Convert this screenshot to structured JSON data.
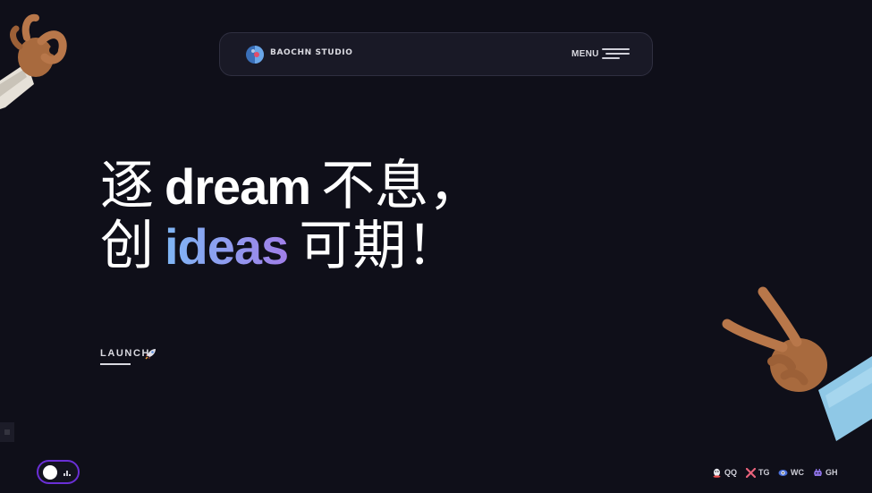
{
  "header": {
    "brand": "BAOCHN STUDIO",
    "menu_label": "MENU"
  },
  "hero": {
    "line1_part1": "逐",
    "line1_word": "dream",
    "line1_part2": "不息，",
    "line2_part1": "创",
    "line2_word": "ideas",
    "line2_part2": "可期！"
  },
  "launch": {
    "label": "LAUNCH"
  },
  "socials": {
    "qq": "QQ",
    "tg": "TG",
    "wc": "WC",
    "gh": "GH"
  },
  "colors": {
    "background": "#0f0f19",
    "navbar": "#191926",
    "gradient_start": "#7fb6f5",
    "gradient_end": "#a07ee8",
    "toggle_border": "#6a2fd6"
  },
  "icons": [
    "logo-icon",
    "menu-icon",
    "rocket-icon",
    "theme-toggle-icon",
    "qq-icon",
    "tg-icon",
    "wc-icon",
    "gh-icon",
    "ok-hand-icon",
    "rock-hand-icon"
  ]
}
